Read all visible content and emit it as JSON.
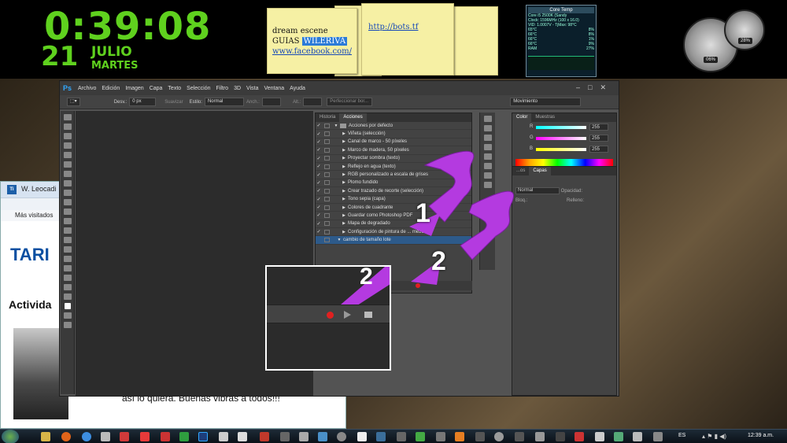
{
  "clock": {
    "time": "0:39:08",
    "day": "21",
    "month": "JULIO",
    "weekday": "MARTES"
  },
  "sticky_notes": {
    "note1": {
      "line1": "dream escene",
      "line2_plain": "GUIAS ",
      "line2_highlight": "WILERIVA",
      "line3": "www.facebook.com/"
    },
    "note2": {
      "link": "http://bots.tf"
    }
  },
  "core_temp": {
    "title": "Core Temp",
    "cpu": "Core i5 2500K (Sandy",
    "clock": "Clock: 1596MHz (100 x 16.0)",
    "vid": "VID: 1.0007V - TjMax: 98°C",
    "cores": [
      {
        "temp": "65°C",
        "load": "8%"
      },
      {
        "temp": "66°C",
        "load": "8%"
      },
      {
        "temp": "66°C",
        "load": "1%"
      },
      {
        "temp": "66°C",
        "load": "9%"
      }
    ],
    "ram_label": "RAM",
    "ram_value": "27%"
  },
  "gauges": {
    "g1": "06%",
    "g2": "28%"
  },
  "browser": {
    "title": "W. Leocadi",
    "favorites": "Más visitados",
    "brand": "TARI",
    "heading": "Activida",
    "body_text": "así lo quiera. Buenas vibras a todos!!!"
  },
  "photoshop": {
    "logo": "Ps",
    "menu": [
      "Archivo",
      "Edición",
      "Imagen",
      "Capa",
      "Texto",
      "Selección",
      "Filtro",
      "3D",
      "Vista",
      "Ventana",
      "Ayuda"
    ],
    "options": {
      "desv_label": "Desv.:",
      "desv_value": "0 px",
      "suavizar": "Suavizar",
      "estilo_label": "Estilo:",
      "estilo_value": "Normal",
      "anch_label": "Anch.:",
      "alt_label": "Alt.:",
      "perfeccionar": "Perfeccionar bor...",
      "workspace": "Movimiento"
    },
    "actions_panel": {
      "tabs": [
        "Historia",
        "Acciones"
      ],
      "set_name": "Acciones por defecto",
      "items": [
        "Viñeta (selección)",
        "Canal de marco - 50 píxeles",
        "Marco de madera, 50 píxeles",
        "Proyectar sombra (texto)",
        "Reflejo en agua (texto)",
        "RGB personalizado a escala de grises",
        "Plomo fundido",
        "Crear trazado de recorte (selección)",
        "Tono sepia (capa)",
        "Colores de cuadrante",
        "Guardar como Photoshop PDF",
        "Mapa de degradado",
        "Configuración de pintura de ... mezcl..."
      ],
      "selected_item": "cambio de tamaño lote"
    },
    "color_panel": {
      "tabs": [
        "Color",
        "Muestras"
      ],
      "channels": [
        {
          "label": "R",
          "value": "255",
          "color": "#ff3333"
        },
        {
          "label": "G",
          "value": "255",
          "color": "#33ff33"
        },
        {
          "label": "B",
          "value": "255",
          "color": "#3366ff"
        }
      ]
    },
    "layers_panel": {
      "tabs": [
        "...os",
        "Capas"
      ],
      "blend_mode": "Normal",
      "opacity_label": "Opacidad:",
      "lock_label": "Bloq.:",
      "fill_label": "Relleno:"
    }
  },
  "annotations": {
    "arrow1_number": "1",
    "arrow2_number": "2",
    "zoom_number": "2"
  },
  "taskbar": {
    "language": "ES",
    "time": "12:39 a.m."
  }
}
